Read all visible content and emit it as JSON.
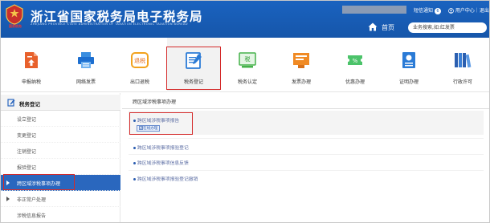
{
  "header": {
    "title": "浙江省国家税务局电子税务局",
    "subtitle": "ZHEJIANG PROVINCE STATE ADMINISTRATION OF TAXATION ELECTRONIC TAXATION BUREAU",
    "emblem_caption": "国家税务",
    "notice_label": "短信通知",
    "notice_count": "6",
    "user_center_label": "用户中心｜退出",
    "home_label": "首页",
    "search_placeholder": "业务搜索,如:红发票"
  },
  "nav": {
    "items": [
      {
        "label": "申报纳税",
        "icon": "tax-declaration-icon"
      },
      {
        "label": "网络发票",
        "icon": "online-invoice-icon"
      },
      {
        "label": "出口退税",
        "icon": "export-rebate-icon"
      },
      {
        "label": "税务登记",
        "icon": "tax-registration-icon"
      },
      {
        "label": "税务认定",
        "icon": "tax-certification-icon"
      },
      {
        "label": "发票办理",
        "icon": "invoice-handling-icon"
      },
      {
        "label": "优惠办理",
        "icon": "preferential-handling-icon"
      },
      {
        "label": "证明办理",
        "icon": "certificate-handling-icon"
      },
      {
        "label": "行政许可",
        "icon": "administrative-license-icon"
      }
    ],
    "active_index": 3
  },
  "sidebar": {
    "header": "税务登记",
    "items": [
      {
        "label": "设立登记"
      },
      {
        "label": "变更登记"
      },
      {
        "label": "注销登记"
      },
      {
        "label": "报验登记"
      },
      {
        "label": "跨区域涉税事项办理"
      },
      {
        "label": "非正常户处理"
      },
      {
        "label": "涉税信息报告"
      }
    ],
    "active_index": 4
  },
  "main": {
    "heading": "跨区域涉税事项办理",
    "tasks": [
      {
        "label": "跨区域涉税事项报告",
        "action": "在线办理"
      },
      {
        "label": "跨区域涉税事项报验登记"
      },
      {
        "label": "跨区域涉税事项信息反馈"
      },
      {
        "label": "跨区域涉税事项报验登记撤销"
      }
    ]
  },
  "colors": {
    "brand_blue": "#1a63c0",
    "highlight_red": "#d42a2a",
    "active_sidebar": "#2a67be"
  }
}
